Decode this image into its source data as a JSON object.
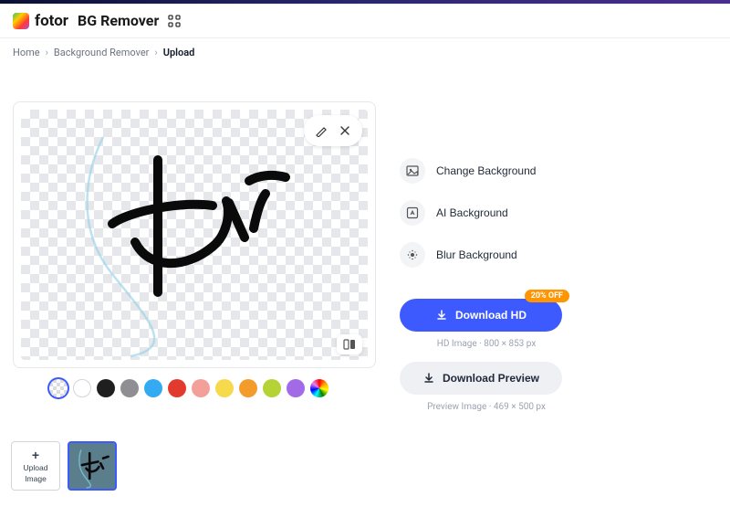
{
  "header": {
    "brand": "fotor",
    "product": "BG Remover"
  },
  "breadcrumb": {
    "home": "Home",
    "bgremover": "Background Remover",
    "current": "Upload"
  },
  "actions": {
    "change_bg": "Change Background",
    "ai_bg": "AI Background",
    "blur_bg": "Blur Background"
  },
  "discount_badge": "20% OFF",
  "download": {
    "hd_label": "Download HD",
    "hd_caption": "HD Image · 800 × 853 px",
    "preview_label": "Download Preview",
    "preview_caption": "Preview Image · 469 × 500 px"
  },
  "upload_tile": {
    "line1": "Upload",
    "line2": "Image"
  },
  "swatches": [
    {
      "name": "transparent",
      "class": "transparent selected"
    },
    {
      "name": "white",
      "class": "white"
    },
    {
      "name": "black",
      "style": "background:#1f1f1f"
    },
    {
      "name": "gray",
      "style": "background:#8e8e93"
    },
    {
      "name": "sky",
      "style": "background:#34aaf2"
    },
    {
      "name": "red",
      "style": "background:#e23b2e"
    },
    {
      "name": "pink",
      "style": "background:#f4a09a"
    },
    {
      "name": "yellow",
      "style": "background:#f7d94c"
    },
    {
      "name": "orange",
      "style": "background:#f39c2c"
    },
    {
      "name": "lime",
      "style": "background:#b4d335"
    },
    {
      "name": "purple",
      "style": "background:#a26ae6"
    },
    {
      "name": "rainbow",
      "class": "rainbow"
    }
  ]
}
